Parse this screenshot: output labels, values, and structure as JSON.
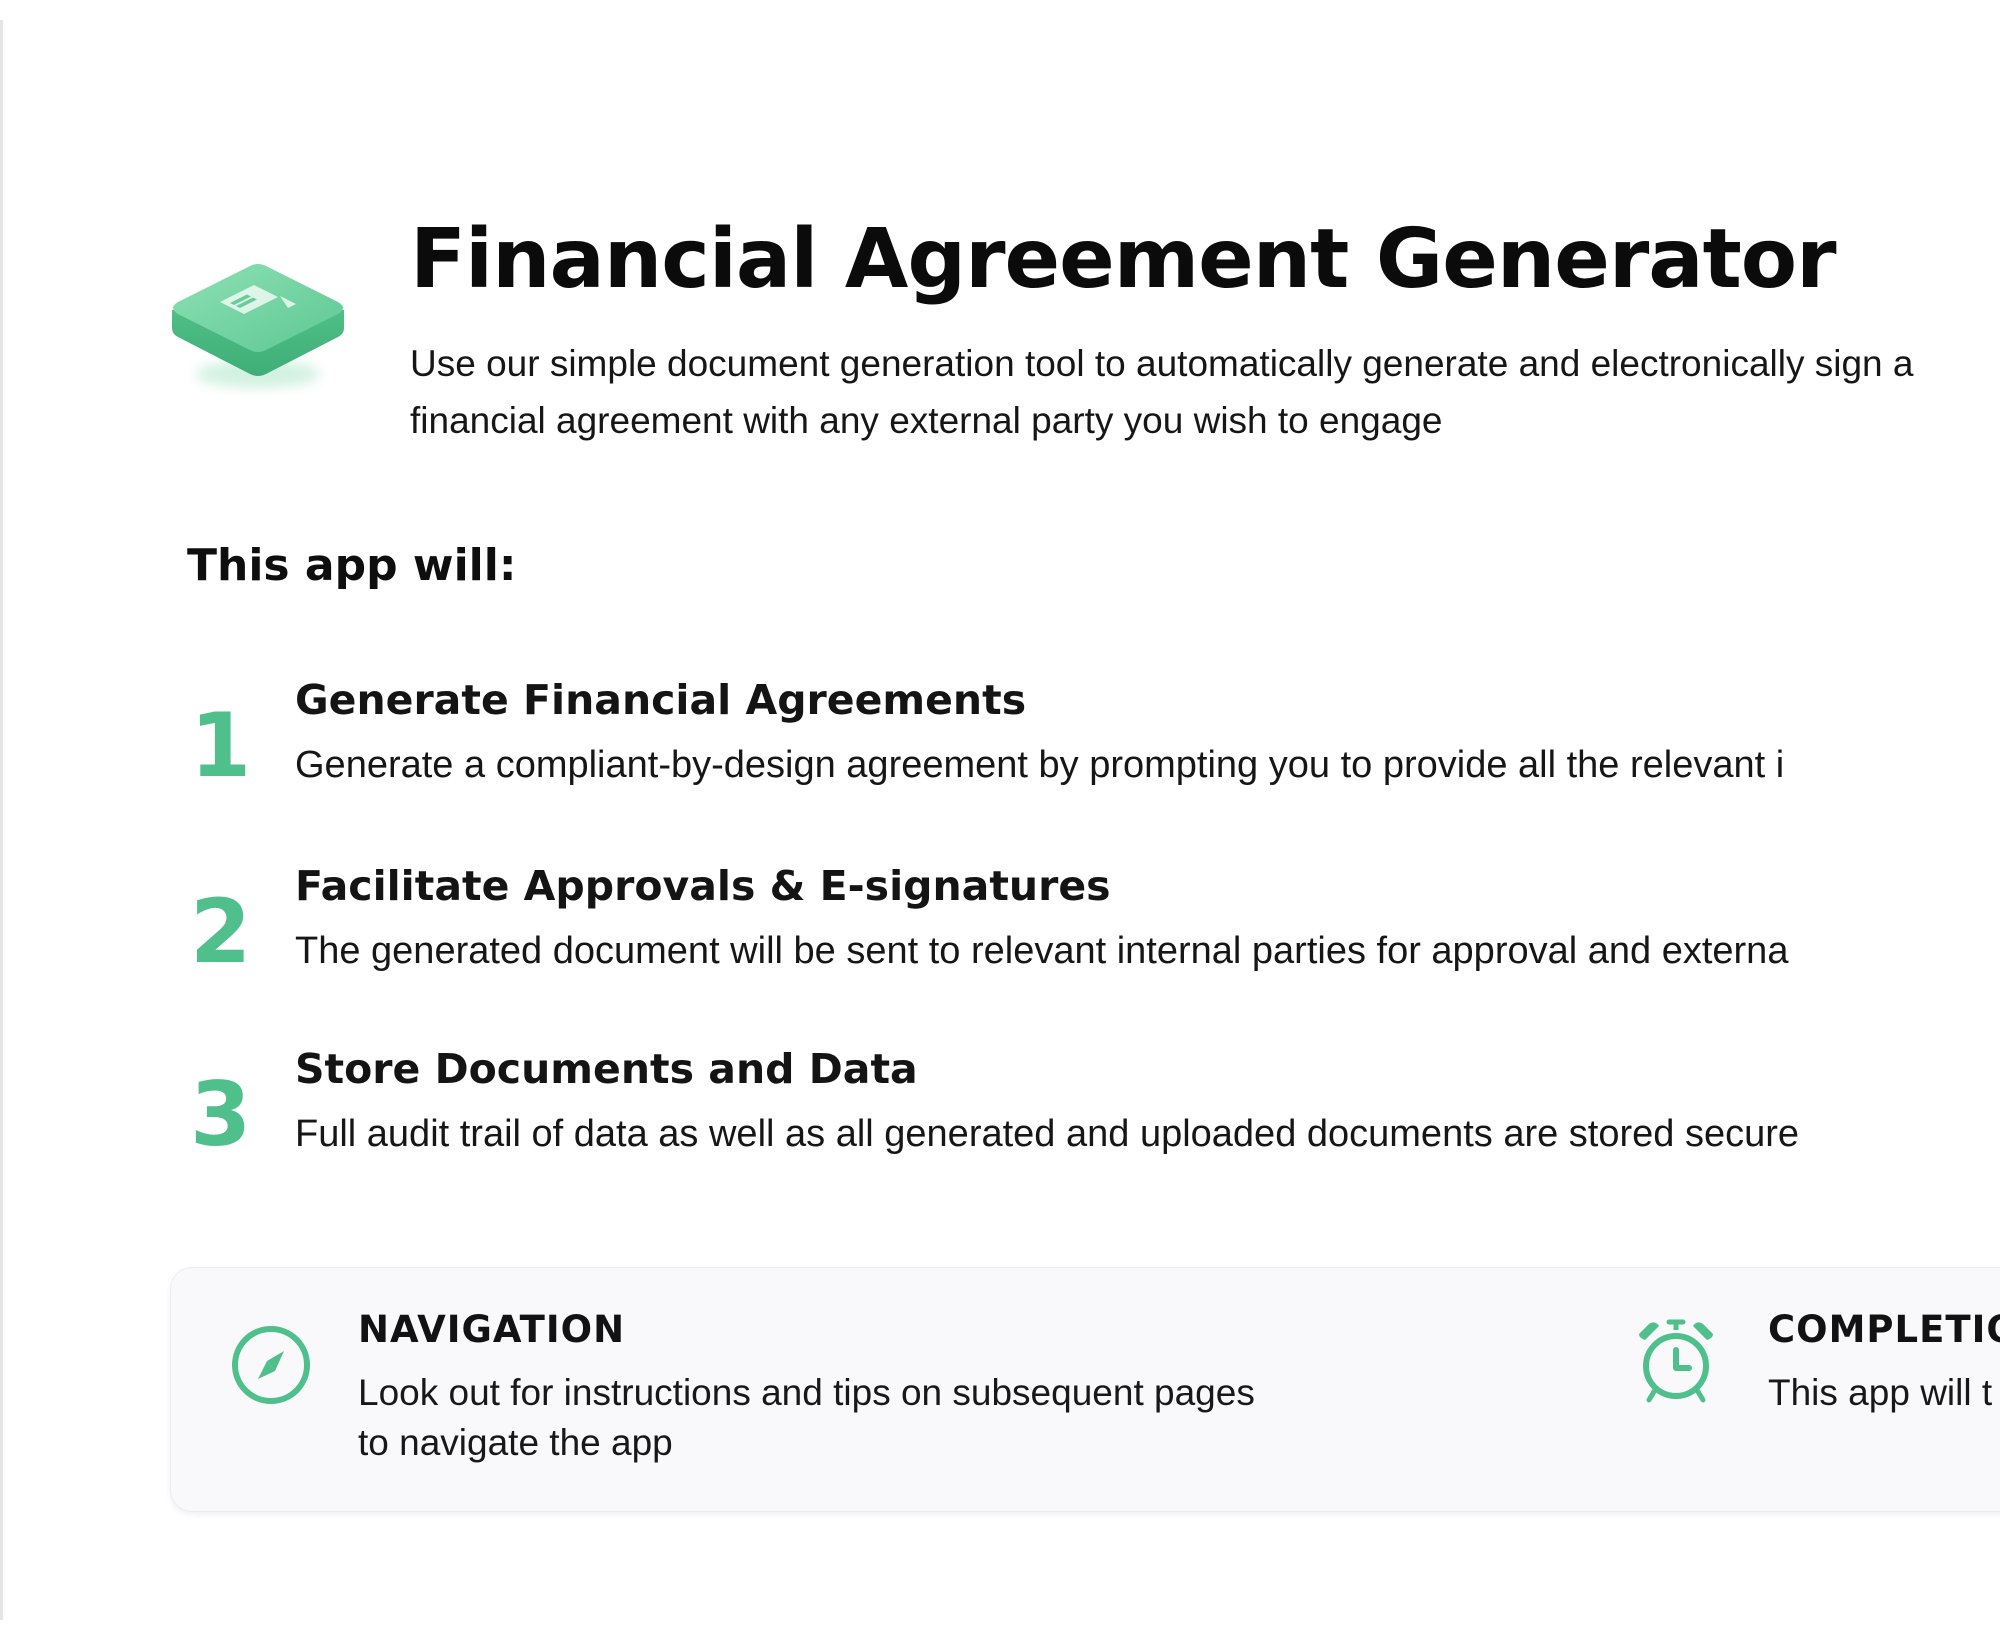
{
  "colors": {
    "accent": "#4fbf8b",
    "panel_background": "#f9f9fb"
  },
  "header": {
    "icon": "document-tile-icon",
    "title": "Financial Agreement Generator",
    "subtitle": "Use our simple document generation tool to automatically generate and electronically sign a financial agreement with any external party you wish to engage"
  },
  "features": {
    "heading": "This app will:",
    "items": [
      {
        "number": "1",
        "title": "Generate Financial Agreements",
        "description": "Generate a compliant-by-design agreement by prompting you to provide all the relevant i"
      },
      {
        "number": "2",
        "title": "Facilitate Approvals & E-signatures",
        "description": "The generated document will be sent to relevant internal parties for approval and externa"
      },
      {
        "number": "3",
        "title": "Store Documents and Data",
        "description": "Full audit trail of data as well as all generated and uploaded documents are stored secure"
      }
    ]
  },
  "info_panel": {
    "navigation": {
      "icon": "compass-icon",
      "title": "NAVIGATION",
      "text": "Look out for instructions and tips on subsequent pages to navigate the app"
    },
    "completion": {
      "icon": "alarm-clock-icon",
      "title": "COMPLETION",
      "text": "This app will t"
    }
  }
}
